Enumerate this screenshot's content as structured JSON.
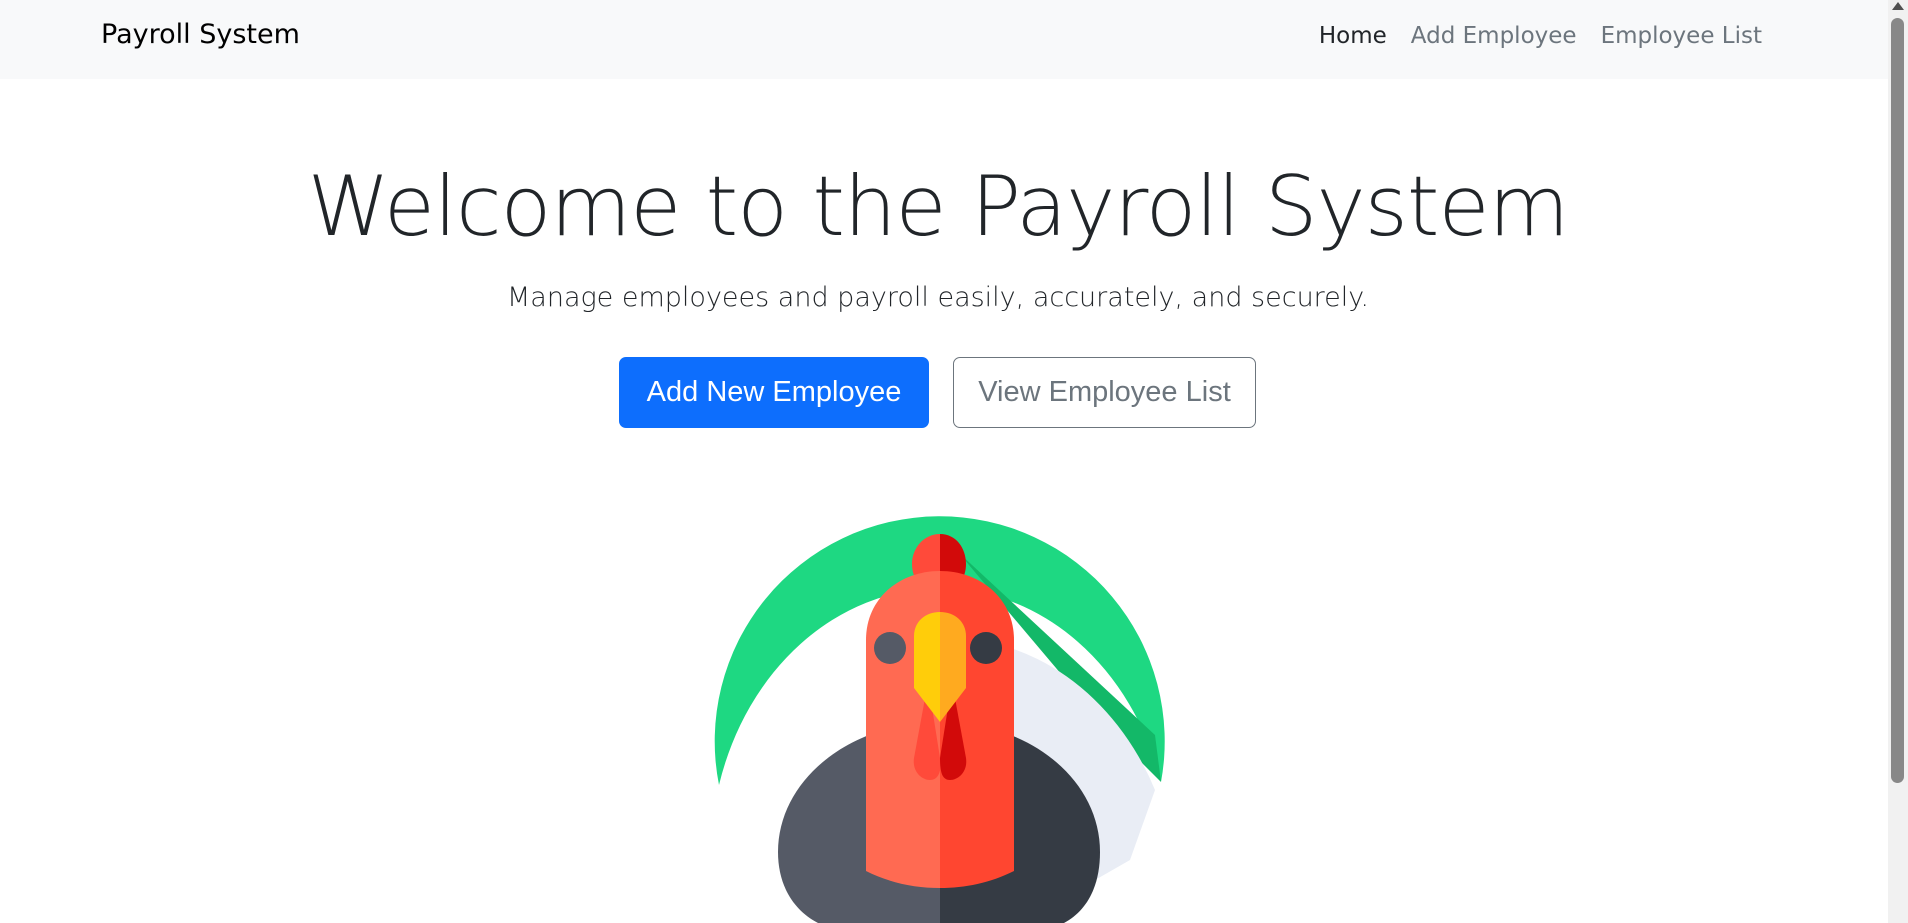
{
  "navbar": {
    "brand": "Payroll System",
    "links": [
      {
        "label": "Home",
        "active": true
      },
      {
        "label": "Add Employee",
        "active": false
      },
      {
        "label": "Employee List",
        "active": false
      }
    ]
  },
  "hero": {
    "title": "Welcome to the Payroll System",
    "subtitle": "Manage employees and payroll easily, accurately, and securely.",
    "primary_button": "Add New Employee",
    "secondary_button": "View Employee List",
    "illustration": "rooster-icon"
  },
  "colors": {
    "navbar_bg": "#f8f9fa",
    "primary": "#0d6efd",
    "secondary": "#6c757d",
    "illustration_green": "#1ed882",
    "illustration_red": "#ff6a52",
    "illustration_dark": "#353b44",
    "illustration_yellow": "#ffc90e"
  }
}
